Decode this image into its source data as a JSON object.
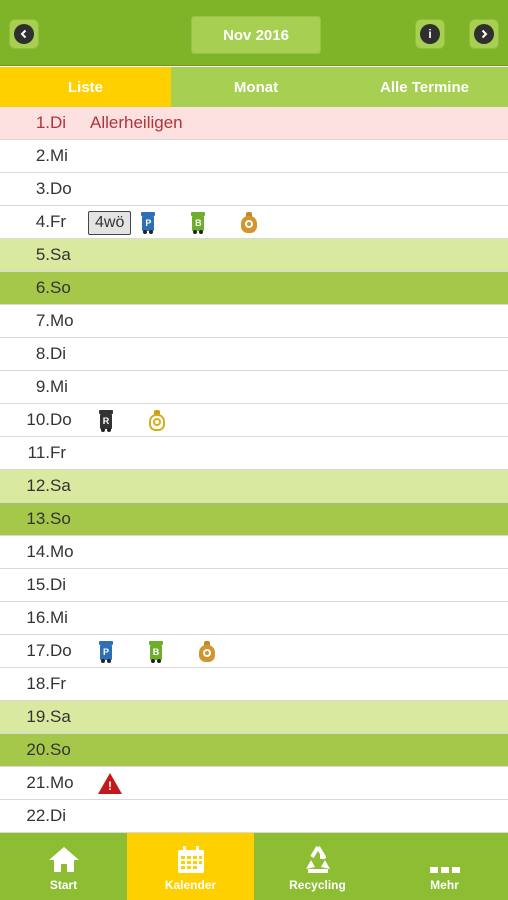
{
  "header": {
    "month_label": "Nov 2016",
    "prev_icon": "chevron-left-icon",
    "next_icon": "chevron-right-icon",
    "info_icon": "info-icon"
  },
  "tabs": [
    {
      "label": "Liste",
      "active": true
    },
    {
      "label": "Monat",
      "active": false
    },
    {
      "label": "Alle Termine",
      "active": false
    }
  ],
  "days": [
    {
      "day": "1.",
      "dow": "Di",
      "event": "Allerheiligen"
    },
    {
      "day": "2.",
      "dow": "Mi"
    },
    {
      "day": "3.",
      "dow": "Do"
    },
    {
      "day": "4.",
      "dow": "Fr",
      "badge": "4wö",
      "icons": [
        "paper-bin-icon",
        "bio-bin-icon",
        "bag-icon"
      ]
    },
    {
      "day": "5.",
      "dow": "Sa"
    },
    {
      "day": "6.",
      "dow": "So"
    },
    {
      "day": "7.",
      "dow": "Mo"
    },
    {
      "day": "8.",
      "dow": "Di"
    },
    {
      "day": "9.",
      "dow": "Mi"
    },
    {
      "day": "10.",
      "dow": "Do",
      "icons": [
        "residual-bin-icon",
        "yellow-bag-icon"
      ]
    },
    {
      "day": "11.",
      "dow": "Fr"
    },
    {
      "day": "12.",
      "dow": "Sa"
    },
    {
      "day": "13.",
      "dow": "So"
    },
    {
      "day": "14.",
      "dow": "Mo"
    },
    {
      "day": "15.",
      "dow": "Di"
    },
    {
      "day": "16.",
      "dow": "Mi"
    },
    {
      "day": "17.",
      "dow": "Do",
      "icons": [
        "paper-bin-icon",
        "bio-bin-icon",
        "bag-icon"
      ]
    },
    {
      "day": "18.",
      "dow": "Fr"
    },
    {
      "day": "19.",
      "dow": "Sa"
    },
    {
      "day": "20.",
      "dow": "So"
    },
    {
      "day": "21.",
      "dow": "Mo",
      "icons": [
        "warning-icon"
      ]
    },
    {
      "day": "22.",
      "dow": "Di"
    }
  ],
  "bin_letters": {
    "paper": "P",
    "bio": "B",
    "residual": "R"
  },
  "bottom_nav": [
    {
      "label": "Start",
      "icon": "home-icon"
    },
    {
      "label": "Kalender",
      "icon": "calendar-icon",
      "active": true
    },
    {
      "label": "Recycling",
      "icon": "recycle-icon"
    },
    {
      "label": "Mehr",
      "icon": "more-icon"
    }
  ],
  "colors": {
    "header_green": "#7fb428",
    "tab_active_yellow": "#ffd000",
    "saturday_row": "#d9e9a0",
    "sunday_row": "#a6c84a",
    "holiday_row": "#fde0e0",
    "holiday_text": "#b0333a"
  }
}
